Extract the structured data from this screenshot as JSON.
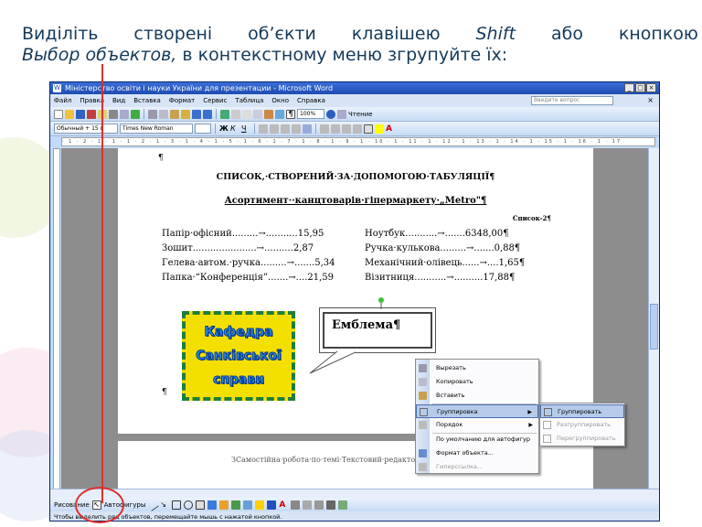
{
  "slide": {
    "line1_words": [
      "Виділіть",
      "створені",
      "об’єкти",
      "клавішею",
      "Shift",
      "або",
      "кнопкою"
    ],
    "line2_italic": "Выбор объектов,",
    "line2_rest": " в контекстному меню згрупуйте їх:"
  },
  "window": {
    "title": "Міністерство освіти і науки України для презентации - Microsoft Word",
    "menu": [
      "Файл",
      "Правка",
      "Вид",
      "Вставка",
      "Формат",
      "Сервис",
      "Таблица",
      "Окно",
      "Справка"
    ],
    "help_placeholder": "Введите вопрос",
    "zoom": "100%",
    "reading_label": "Чтение",
    "style_value": "Обычный + 15 г",
    "font_value": "Times New Roman",
    "ruler_text": "· 1 · 2 · 1 · 1 · 1 · 2 · 1 · 3 · 1 · 4 · 1 · 5 · 1 · 6 · 1 · 7 · 1 · 8 · 1 · 9 · 1 · 10 · 1 · 11 · 1 · 12 · 1 · 13 · 1 · 14 · 1 · 15 · 1 · 16 · 1 · 17"
  },
  "document": {
    "pilcrow": "¶",
    "title": "СПИСОК,·СТВОРЕНИЙ·ЗА·ДОПОМОГОЮ·ТАБУЛЯЦІЇ¶",
    "subtitle": "Асортимент··канцтоварів·гіпермаркету·„Metro\"¶",
    "list_label": "Список-2¶",
    "rows": [
      {
        "left": "Папір·офісний.........→...........15,95",
        "right": "Ноутбук...........→.......6348,00¶"
      },
      {
        "left": "Зошит......................→..........2,87",
        "right": "Ручка·кулькова.........→.......0,88¶"
      },
      {
        "left": "Гелева·автом.·ручка.........→.......5,34",
        "right": "Механічний·олівець......→....1,65¶"
      },
      {
        "left": "Папка·“Конференція”.......→....21,59",
        "right": "Візитниця...........→..........17,88¶"
      }
    ],
    "wordart_lines": [
      "Кафедра",
      "Санківської",
      "справи"
    ],
    "callout_text": "Емблема¶",
    "footer": "ЗСамостійна·робота·по·темі·Текстовий·редактор·MS-Word¶"
  },
  "context_menu": {
    "items": [
      "Вырезать",
      "Копировать",
      "Вставить",
      "Группировка",
      "Порядок",
      "По умолчанию для автофигур",
      "Формат объекта...",
      "Гиперссылка..."
    ],
    "submenu": [
      "Группировать",
      "Разгруппировать",
      "Перегруппировать"
    ]
  },
  "draw_toolbar": {
    "drawing_label": "Рисование",
    "autoshapes_label": "Автофигуры"
  },
  "status_text": "Чтобы выделить ряд объектов, перемещайте мышь с нажатой кнопкой.",
  "colors": {
    "title_blue": "#143a5a",
    "menu_highlight": "#b6cbea",
    "emblem_yellow": "#f4e000",
    "emblem_border": "#1f7e3c",
    "pointer_red": "#e03030"
  }
}
